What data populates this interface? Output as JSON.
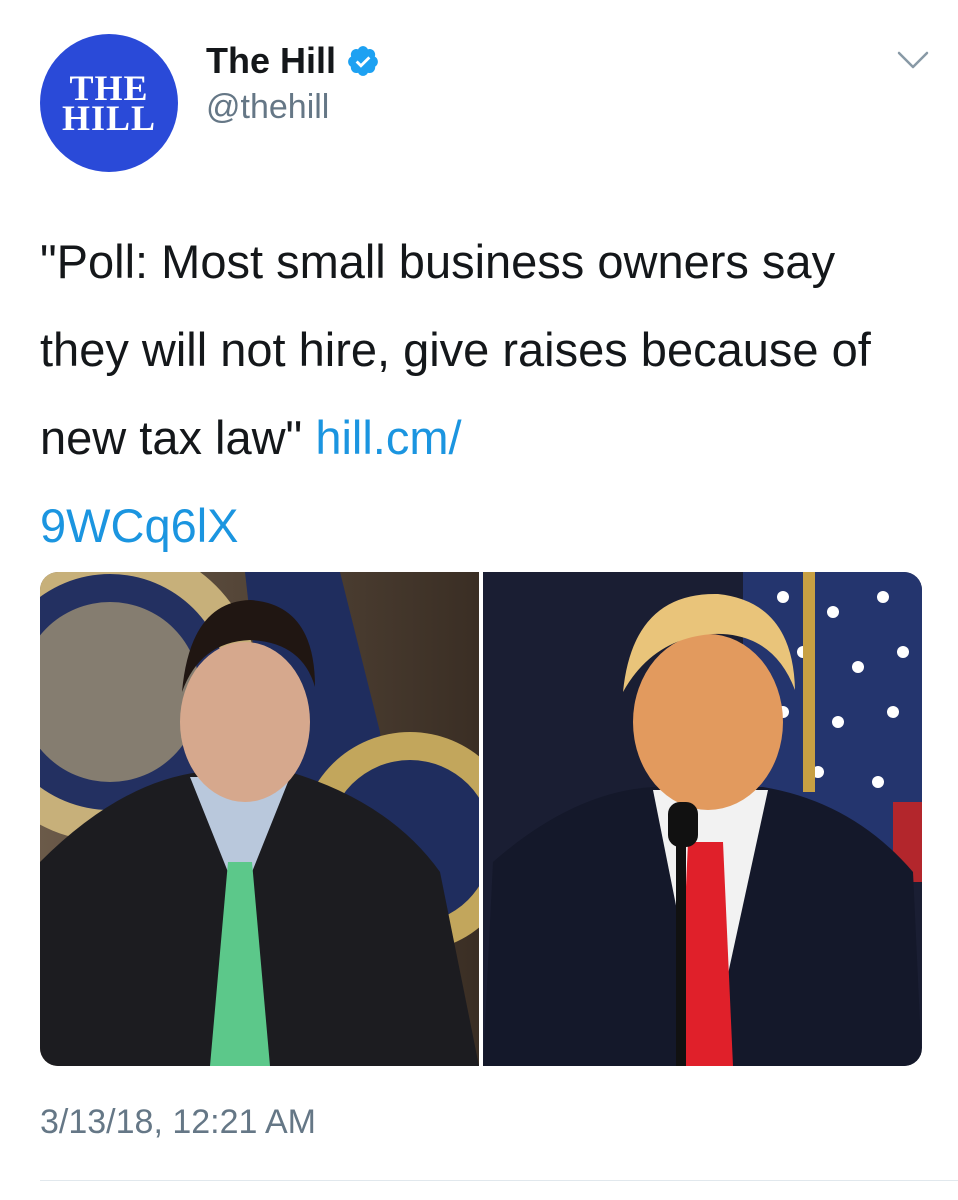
{
  "account": {
    "avatar_text_line1": "THE",
    "avatar_text_line2": "HILL",
    "display_name": "The Hill",
    "handle": "@thehill",
    "verified": true,
    "avatar_color": "#2a4ad8"
  },
  "tweet": {
    "text": "\"Poll: Most small business owners say they will not hire, give raises because of new tax law\" ",
    "link_text": "hill.cm/\n9WCq6lX",
    "link_color": "#1b95e0",
    "timestamp": "3/13/18, 12:21 AM"
  },
  "media": {
    "count": 2
  },
  "icons": {
    "verified": "verified-badge-icon",
    "menu": "chevron-down-icon"
  }
}
